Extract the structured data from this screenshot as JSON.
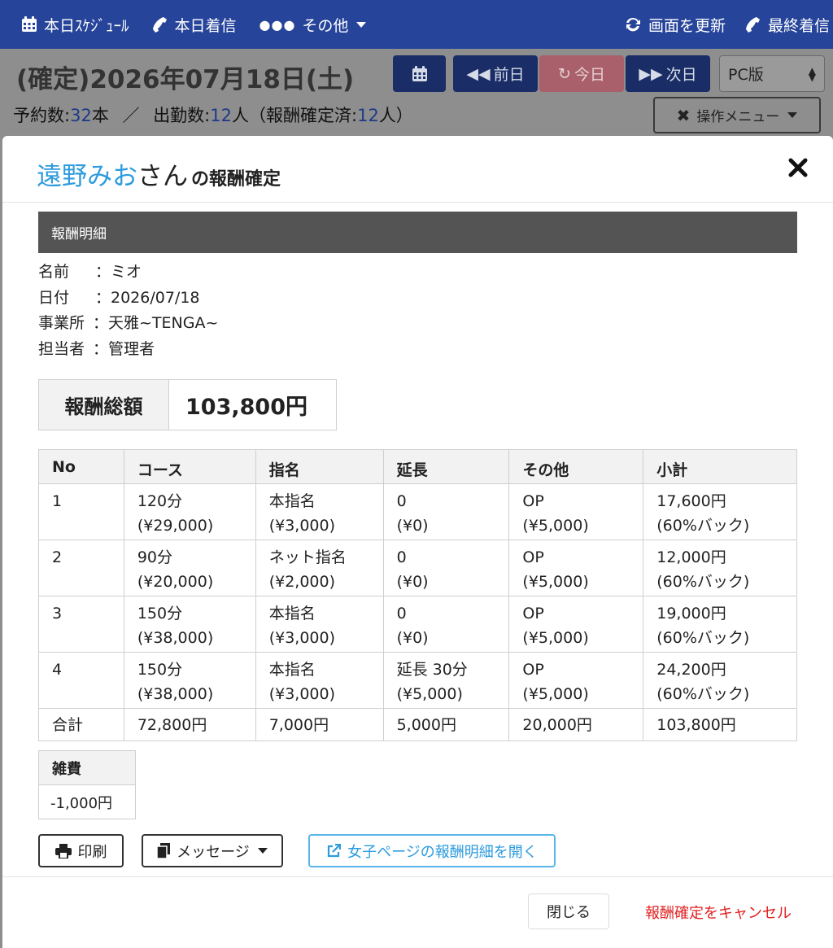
{
  "nav": {
    "schedule": "本日ｽｹｼﾞｭｰﾙ",
    "calls": "本日着信",
    "other": "その他",
    "refresh": "画面を更新",
    "last_call": "最終着信"
  },
  "page": {
    "title": "(確定)2026年07月18日(土)",
    "stats": {
      "reserve_label": "予約数:",
      "reserve_num": "32",
      "reserve_unit": "本",
      "sep": "／",
      "attend_label": "出勤数:",
      "attend_num": "12",
      "attend_unit": "人（報酬確定済:",
      "confirmed_num": "12",
      "confirmed_unit": "人）"
    },
    "prev": "前日",
    "today": "今日",
    "next": "次日",
    "version": "PC版",
    "ops_menu": "操作メニュー"
  },
  "modal": {
    "name": "遠野みお",
    "san": "さん",
    "suffix": "の報酬確定",
    "section": "報酬明細",
    "info": [
      {
        "k": "名前",
        "v": "：ミオ"
      },
      {
        "k": "日付",
        "v": "：2026/07/18"
      },
      {
        "k": "事業所",
        "v": "：天雅~TENGA~"
      },
      {
        "k": "担当者",
        "v": "：管理者"
      }
    ],
    "total_label": "報酬総額",
    "total_value": "103,800円",
    "table": {
      "headers": [
        "No",
        "コース",
        "指名",
        "延長",
        "その他",
        "小計"
      ],
      "rows": [
        {
          "no": "1",
          "course": [
            "120分",
            "(¥29,000)"
          ],
          "nom": [
            "本指名",
            "(¥3,000)"
          ],
          "ext": [
            "0",
            "(¥0)"
          ],
          "other": [
            "OP",
            "(¥5,000)"
          ],
          "sub": [
            "17,600円",
            "(60%バック)"
          ]
        },
        {
          "no": "2",
          "course": [
            "90分",
            "(¥20,000)"
          ],
          "nom": [
            "ネット指名",
            "(¥2,000)"
          ],
          "ext": [
            "0",
            "(¥0)"
          ],
          "other": [
            "OP",
            "(¥5,000)"
          ],
          "sub": [
            "12,000円",
            "(60%バック)"
          ]
        },
        {
          "no": "3",
          "course": [
            "150分",
            "(¥38,000)"
          ],
          "nom": [
            "本指名",
            "(¥3,000)"
          ],
          "ext": [
            "0",
            "(¥0)"
          ],
          "other": [
            "OP",
            "(¥5,000)"
          ],
          "sub": [
            "19,000円",
            "(60%バック)"
          ]
        },
        {
          "no": "4",
          "course": [
            "150分",
            "(¥38,000)"
          ],
          "nom": [
            "本指名",
            "(¥3,000)"
          ],
          "ext": [
            "延長 30分",
            "(¥5,000)"
          ],
          "other": [
            "OP",
            "(¥5,000)"
          ],
          "sub": [
            "24,200円",
            "(60%バック)"
          ]
        }
      ],
      "sum": [
        "合計",
        "72,800円",
        "7,000円",
        "5,000円",
        "20,000円",
        "103,800円"
      ]
    },
    "misc_label": "雑費",
    "misc_value": "-1,000円",
    "print": "印刷",
    "message": "メッセージ",
    "open_page": "女子ページの報酬明細を開く",
    "close": "閉じる",
    "cancel": "報酬確定をキャンセル"
  }
}
